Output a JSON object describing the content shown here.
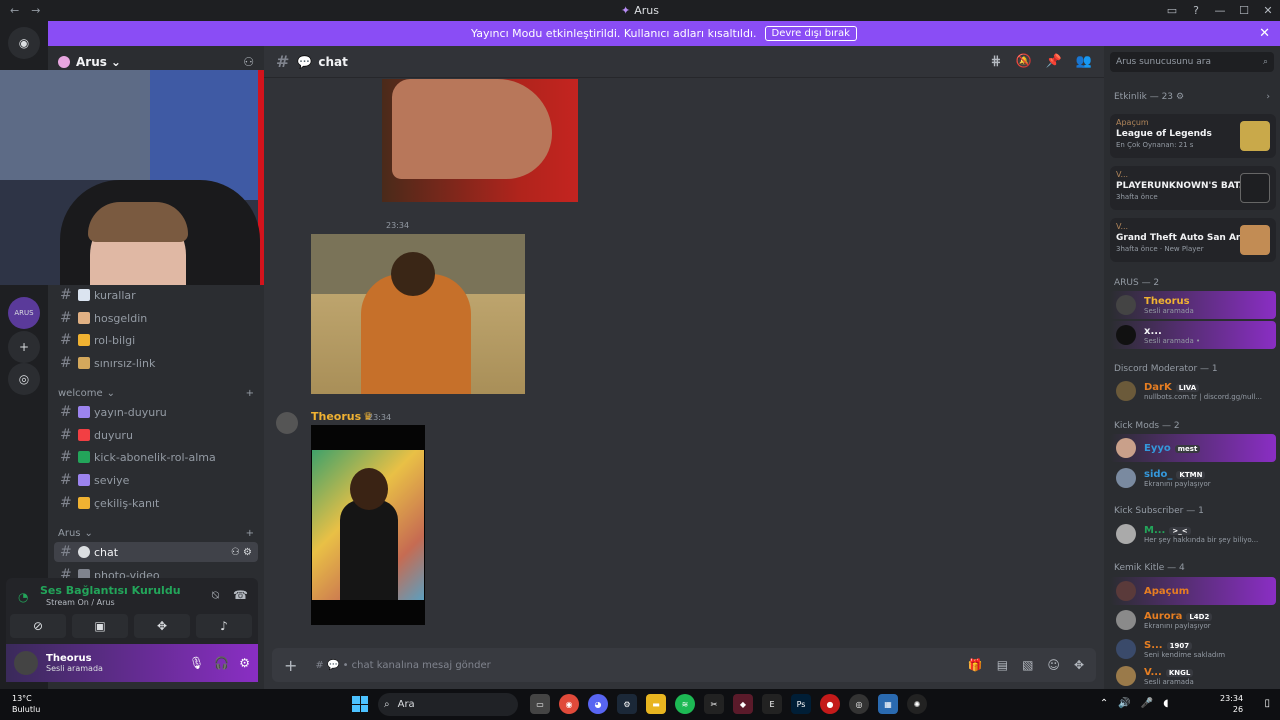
{
  "window": {
    "title": "Arus",
    "controls": [
      "—",
      "☐",
      "✕"
    ]
  },
  "banner": {
    "text": "Yayıncı Modu etkinleştirildi. Kullanıcı adları kısaltıldı.",
    "button": "Devre dışı bırak"
  },
  "server": {
    "name": "Arus",
    "rail_label": "ARUS"
  },
  "channels": {
    "top": [
      {
        "name": "kurallar",
        "emoji_color": "#dbe4f0"
      },
      {
        "name": "hosgeldin",
        "emoji_color": "#e1b184"
      },
      {
        "name": "rol-bilgi",
        "emoji_color": "#f0b232"
      },
      {
        "name": "sınırsız-link",
        "emoji_color": "#d4a85c"
      }
    ],
    "category_welcome": "welcome",
    "welcome": [
      {
        "name": "yayın-duyuru",
        "emoji_color": "#9c84ef"
      },
      {
        "name": "duyuru",
        "emoji_color": "#f23f43"
      },
      {
        "name": "kick-abonelik-rol-alma",
        "emoji_color": "#23a55a"
      },
      {
        "name": "seviye",
        "emoji_color": "#9c84ef"
      },
      {
        "name": "çekiliş-kanıt",
        "emoji_color": "#f0b232"
      }
    ],
    "category_arus": "Arus",
    "arus": [
      {
        "name": "chat",
        "active": true
      },
      {
        "name": "photo-video",
        "active": false
      }
    ]
  },
  "voice": {
    "status": "Ses Bağlantısı Kuruldu",
    "sub": "Stream On / Arus"
  },
  "user": {
    "name": "Theorus",
    "status": "Sesli aramada"
  },
  "chat": {
    "channel": "chat",
    "first_time": "23:34",
    "message": {
      "author": "Theorus",
      "time": "23:34"
    },
    "composer_placeholder": "chat kanalına mesaj gönder"
  },
  "members": {
    "search_placeholder": "Arus sunucusunu ara",
    "activity_header": "Etkinlik — 23",
    "activities": [
      {
        "user": "Apaçum",
        "game": "League of Legends",
        "meta": "En Çok Oynanan: 21 s",
        "thumb_color": "#c9a94a"
      },
      {
        "user": "V...",
        "game": "PLAYERUNKNOWN'S BAT...",
        "meta": "3hafta önce",
        "thumb_color": "#1e1f22"
      },
      {
        "user": "V...",
        "game": "Grand Theft Auto San Andr...",
        "meta": "3hafta önce",
        "meta2": "New Player",
        "thumb_color": "#c28c54"
      }
    ],
    "groups": [
      {
        "title": "ARUS — 2",
        "members": [
          {
            "name": "Theorus",
            "status": "Sesli aramada",
            "color": "#f0b232",
            "grad": true
          },
          {
            "name": "x...",
            "status": "Sesli aramada •",
            "color": "#f2f3f5",
            "grad": true
          }
        ]
      },
      {
        "title": "Discord Moderator — 1",
        "members": [
          {
            "name": "DarK",
            "tag": "LIVA",
            "status": "nullbots.com.tr | discord.gg/null...",
            "color": "#e67e22",
            "grad": false
          }
        ]
      },
      {
        "title": "Kick Mods — 2",
        "members": [
          {
            "name": "Eyyo",
            "tag": "mest",
            "status": "",
            "color": "#3498db",
            "grad": true
          },
          {
            "name": "sido_",
            "tag": "KTMN",
            "status": "Ekranını paylaşıyor",
            "color": "#3498db",
            "grad": false
          }
        ]
      },
      {
        "title": "Kick Subscriber — 1",
        "members": [
          {
            "name": "M...",
            "tag": ">_<",
            "status": "Her şey hakkında bir şey biliyo...",
            "color": "#23a55a",
            "grad": false
          }
        ]
      },
      {
        "title": "Kemik Kitle — 4",
        "members": [
          {
            "name": "Apaçum",
            "status": "",
            "color": "#e67e22",
            "grad": true
          },
          {
            "name": "Aurora",
            "tag": "L4D2",
            "status": "Ekranını paylaşıyor",
            "color": "#e67e22",
            "grad": false
          },
          {
            "name": "S...",
            "tag": "1907",
            "status": "Seni kendime sakladım",
            "color": "#e67e22",
            "grad": false
          },
          {
            "name": "V...",
            "tag": "KNGL",
            "status": "Sesli aramada",
            "color": "#e67e22",
            "grad": false
          }
        ]
      }
    ]
  },
  "taskbar": {
    "weather_temp": "13°C",
    "weather_desc": "Bulutlu",
    "search": "Ara",
    "time": "23:34",
    "date_suffix": "26"
  },
  "colors": {
    "accent": "#8a4df5",
    "online": "#23a55a"
  }
}
